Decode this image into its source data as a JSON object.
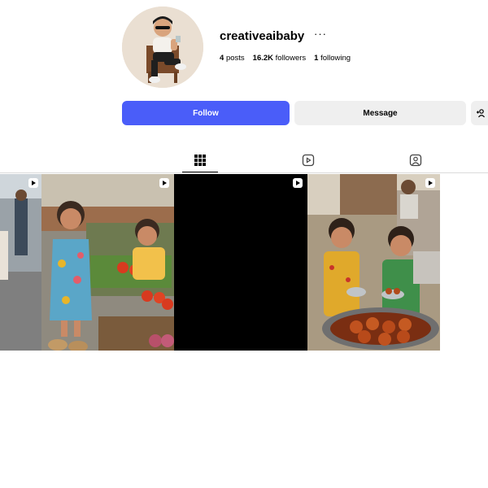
{
  "profile": {
    "username": "creativeaibaby",
    "more_icon": "more-horizontal-icon",
    "stats": {
      "posts_count": "4",
      "posts_label": "posts",
      "followers_count": "16.2K",
      "followers_label": "followers",
      "following_count": "1",
      "following_label": "following"
    }
  },
  "actions": {
    "follow_label": "Follow",
    "message_label": "Message",
    "add_user_icon": "add-user-icon"
  },
  "tabs": [
    {
      "icon": "grid-icon",
      "active": true
    },
    {
      "icon": "reels-icon",
      "active": false
    },
    {
      "icon": "tagged-icon",
      "active": false
    }
  ],
  "posts": [
    {
      "type": "reel",
      "description_icon": "reel-icon"
    },
    {
      "type": "reel",
      "description_icon": "reel-icon"
    },
    {
      "type": "reel",
      "description_icon": "reel-icon"
    },
    {
      "type": "reel",
      "description_icon": "reel-icon"
    }
  ],
  "colors": {
    "accent": "#4a5df9",
    "secondary_button": "#efefef",
    "divider": "#dbdbdb"
  }
}
